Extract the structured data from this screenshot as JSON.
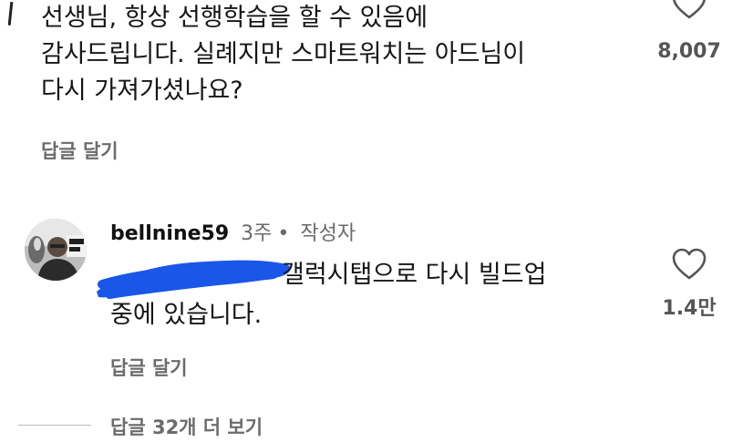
{
  "comment1": {
    "text_line1": "선생님, 항상 선행학습을 할 수 있음에",
    "text_line2": "감사드립니다. 실례지만 스마트워치는 아드님이",
    "text_line3": "다시 가져가셨나요?",
    "reply_label": "답글 달기",
    "like_count": "8,007",
    "like_icon": "heart-icon"
  },
  "comment2": {
    "username": "bellnine59",
    "time": "3주",
    "separator": "•",
    "author_badge": "작성자",
    "text_line1": "갤럭시탭으로 다시 빌드업",
    "text_line2": "중에 있습니다.",
    "reply_label": "답글 달기",
    "like_count": "1.4만",
    "like_icon": "heart-icon",
    "redaction_color": "#1a56e8"
  },
  "thread": {
    "more_replies": "답글 32개 더 보기"
  }
}
